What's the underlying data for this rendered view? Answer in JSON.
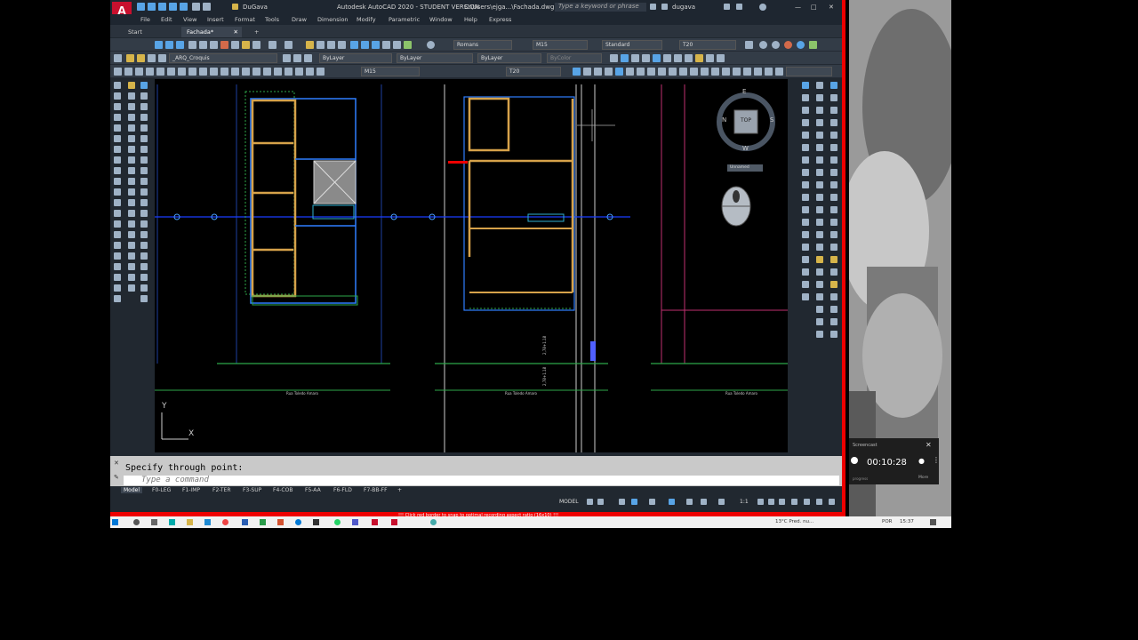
{
  "title_bar": {
    "workspace": "DuGava",
    "app_title": "Autodesk AutoCAD 2020 - STUDENT VERSION",
    "file_path": "C:\\Users\\ejga...\\Fachada.dwg",
    "search_placeholder": "Type a keyword or phrase",
    "user": "dugava"
  },
  "menu": [
    "File",
    "Edit",
    "View",
    "Insert",
    "Format",
    "Tools",
    "Draw",
    "Dimension",
    "Modify",
    "Parametric",
    "Window",
    "Help",
    "Express"
  ],
  "doc_tabs": [
    {
      "label": "Start",
      "active": false
    },
    {
      "label": "Fachada*",
      "active": true
    }
  ],
  "toolbar": {
    "text_style": "Romans",
    "dim_style": "M15",
    "table_style": "Standard",
    "mleader_style": "T20",
    "layer": "_ARQ_Croquis",
    "color": "ByLayer",
    "linetype": "ByLayer",
    "lineweight": "ByLayer",
    "plot_style": "ByColor",
    "dim_style_2": "M15",
    "mleader_style_2": "T20"
  },
  "viewcube": {
    "top": "TOP",
    "north": "N",
    "east": "E",
    "south": "S",
    "west": "W",
    "ucs": "Unnamed"
  },
  "drawing_labels": {
    "street_1": "Rua Toledo Amaro",
    "street_2": "Rua Toledo Amaro",
    "street_3": "Rua Toledo Amaro",
    "level_1": "2,78+1.18",
    "level_2": "2,78+1.18"
  },
  "command": {
    "history": "Specify through point:",
    "placeholder": "Type a command"
  },
  "layout_tabs": [
    "Model",
    "F0-LEG",
    "F1-IMP",
    "F2-TER",
    "F3-SUP",
    "F4-COB",
    "F5-AA",
    "F6-FLD",
    "F7-BB-FF"
  ],
  "status_bar": {
    "mode": "MODEL",
    "scale": "1:1"
  },
  "recording_warning": "!!! Click red border to snap to optimal recording aspect ratio (16x10) !!!",
  "recorder": {
    "title": "Screencast",
    "elapsed": "00:10:28",
    "more": "More",
    "progress": "progress"
  },
  "taskbar": {
    "weather": "13°C  Pred. nu...",
    "lang": "POR",
    "clock": "15:37"
  },
  "colors": {
    "accent_red": "#e00000",
    "autocad_red": "#c8102e",
    "canvas_bg": "#000000",
    "wall_orange": "#d6a24a",
    "wall_blue": "#2f7fff",
    "grid_green": "#2ea84a"
  }
}
